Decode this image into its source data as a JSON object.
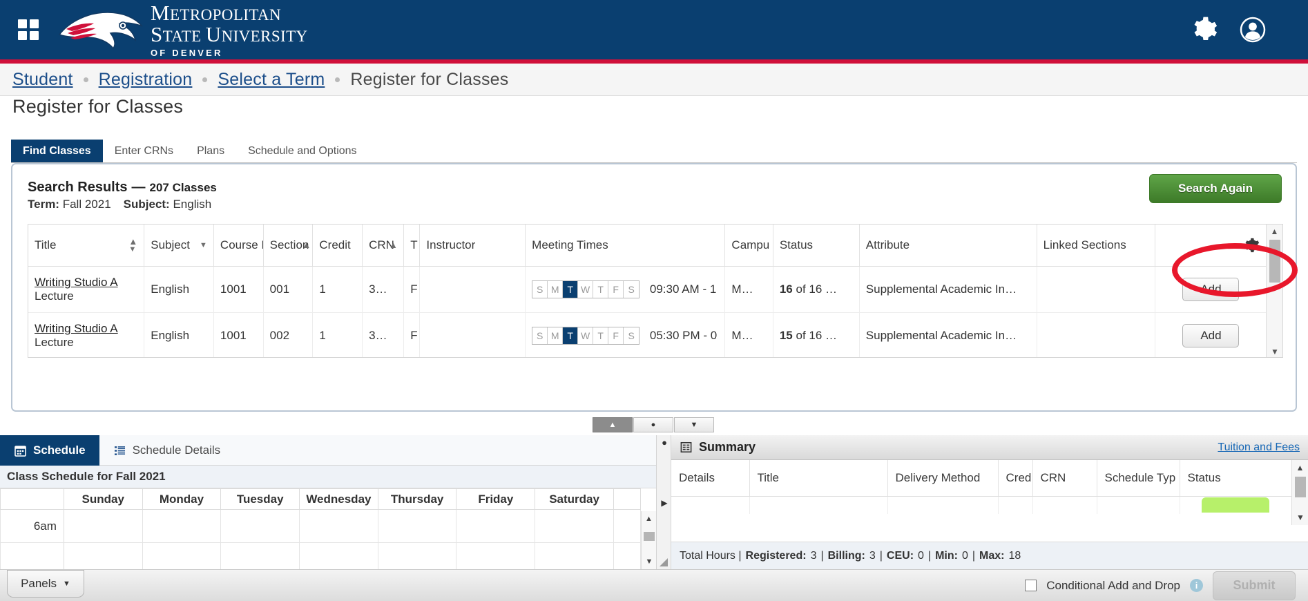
{
  "topbar": {
    "waffle_icon": "grid-apps-icon",
    "logo_line1_a": "M",
    "logo_line1_b": "ETROPOLITAN",
    "logo_line2_a": "S",
    "logo_line2_b": "TATE ",
    "logo_line2_c": "U",
    "logo_line2_d": "NIVERSITY",
    "logo_line3": "OF DENVER",
    "gear_icon": "gear-icon",
    "user_icon": "user-avatar-icon",
    "brand_blue": "#0a3f70",
    "brand_red": "#d0103a"
  },
  "breadcrumb": [
    {
      "label": "Student",
      "link": true
    },
    {
      "label": "Registration",
      "link": true
    },
    {
      "label": "Select a Term",
      "link": true
    },
    {
      "label": "Register for Classes",
      "link": false
    }
  ],
  "page": {
    "title": "Register for Classes"
  },
  "tabs": [
    {
      "label": "Find Classes",
      "active": true
    },
    {
      "label": "Enter CRNs",
      "active": false
    },
    {
      "label": "Plans",
      "active": false
    },
    {
      "label": "Schedule and Options",
      "active": false
    }
  ],
  "search_results": {
    "heading_prefix": "Search Results",
    "heading_dash": "—",
    "heading_count": "207 Classes",
    "term_label": "Term:",
    "term_value": "Fall 2021",
    "subject_label": "Subject:",
    "subject_value": "English",
    "search_again_label": "Search Again"
  },
  "results_table": {
    "columns": [
      {
        "label": "Title",
        "sort": "both"
      },
      {
        "label": "Subject",
        "sort": "down"
      },
      {
        "label": "Course N",
        "sort": "up"
      },
      {
        "label": "Section",
        "sort": "up"
      },
      {
        "label": "Credit",
        "sort": "none"
      },
      {
        "label": "CRN",
        "sort": "up"
      },
      {
        "label": "T",
        "sort": "none"
      },
      {
        "label": "Instructor",
        "sort": "none"
      },
      {
        "label": "Meeting Times",
        "sort": "none"
      },
      {
        "label": "Campu",
        "sort": "none"
      },
      {
        "label": "Status",
        "sort": "none"
      },
      {
        "label": "Attribute",
        "sort": "none"
      },
      {
        "label": "Linked Sections",
        "sort": "none"
      },
      {
        "label": "",
        "sort": "none",
        "icon": "gear-dropdown-icon"
      }
    ],
    "rows": [
      {
        "title_link": "Writing Studio A",
        "title_sub": "Lecture",
        "subject": "English",
        "course": "1001",
        "section": "001",
        "credit": "1",
        "crn": "3…",
        "term": "F",
        "instructor": "",
        "days": [
          {
            "letter": "S",
            "on": false
          },
          {
            "letter": "M",
            "on": false
          },
          {
            "letter": "T",
            "on": true
          },
          {
            "letter": "W",
            "on": false
          },
          {
            "letter": "T",
            "on": false
          },
          {
            "letter": "F",
            "on": false
          },
          {
            "letter": "S",
            "on": false
          }
        ],
        "meeting_time": "09:30 AM - 1",
        "campus": "M…",
        "status_bold": "16",
        "status_rest": " of 16 …",
        "attribute": "Supplemental Academic In…",
        "linked": "",
        "action": "Add"
      },
      {
        "title_link": "Writing Studio A",
        "title_sub": "Lecture",
        "subject": "English",
        "course": "1001",
        "section": "002",
        "credit": "1",
        "crn": "3…",
        "term": "F",
        "instructor": "",
        "days": [
          {
            "letter": "S",
            "on": false
          },
          {
            "letter": "M",
            "on": false
          },
          {
            "letter": "T",
            "on": true
          },
          {
            "letter": "W",
            "on": false
          },
          {
            "letter": "T",
            "on": false
          },
          {
            "letter": "F",
            "on": false
          },
          {
            "letter": "S",
            "on": false
          }
        ],
        "meeting_time": "05:30 PM - 0",
        "campus": "M…",
        "status_bold": "15",
        "status_rest": " of 16 …",
        "attribute": "Supplemental Academic In…",
        "linked": "",
        "action": "Add"
      }
    ]
  },
  "splitter": {
    "collapse_up_icon": "triangle-up-icon",
    "restore_icon": "dot-icon",
    "collapse_down_icon": "triangle-down-icon"
  },
  "schedule_panel": {
    "tabs": [
      {
        "label": "Schedule",
        "icon": "calendar-icon",
        "active": true
      },
      {
        "label": "Schedule Details",
        "icon": "list-detail-icon",
        "active": false
      }
    ],
    "caption": "Class Schedule for Fall 2021",
    "day_headers": [
      "",
      "Sunday",
      "Monday",
      "Tuesday",
      "Wednesday",
      "Thursday",
      "Friday",
      "Saturday"
    ],
    "time_rows": [
      "6am",
      ""
    ]
  },
  "summary_panel": {
    "title": "Summary",
    "title_icon": "summary-grid-icon",
    "tuition_link": "Tuition and Fees",
    "columns": [
      "Details",
      "Title",
      "Delivery Method",
      "Cred",
      "CRN",
      "Schedule Typ",
      "Status"
    ],
    "status_pill_color": "#b7f06a",
    "total_prefix": "Total Hours |",
    "totals": [
      {
        "label": "Registered:",
        "value": "3"
      },
      {
        "label": "Billing:",
        "value": "3"
      },
      {
        "label": "CEU:",
        "value": "0"
      },
      {
        "label": "Min:",
        "value": "0"
      },
      {
        "label": "Max:",
        "value": "18"
      }
    ]
  },
  "footer": {
    "panels_label": "Panels",
    "panels_caret_icon": "caret-down-icon",
    "conditional_label": "Conditional Add and Drop",
    "conditional_checked": false,
    "info_icon": "info-icon",
    "info_glyph": "i",
    "submit_label": "Submit",
    "submit_disabled": true
  }
}
